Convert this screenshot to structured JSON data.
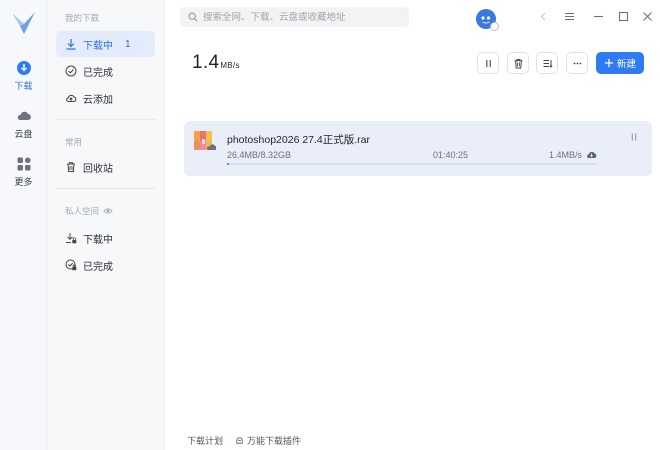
{
  "rail": {
    "items": [
      {
        "label": "下载"
      },
      {
        "label": "云盘"
      },
      {
        "label": "更多"
      }
    ]
  },
  "sidebar": {
    "section_mine": "我的下载",
    "downloading": {
      "label": "下载中",
      "count": "1"
    },
    "completed": "已完成",
    "cloud_add": "云添加",
    "section_common": "常用",
    "recycle": "回收站",
    "section_private": "私人空间",
    "private_downloading": "下载中",
    "private_completed": "已完成"
  },
  "search": {
    "placeholder": "搜索全网、下载、云盘或收藏地址"
  },
  "summary": {
    "speed_value": "1.4",
    "speed_unit": "MB/s"
  },
  "toolbar": {
    "new_label": "新建"
  },
  "task": {
    "name": "photoshop2026 27.4正式版.rar",
    "size": "26.4MB/8.32GB",
    "time_left": "01:40:25",
    "speed": "1.4MB/s",
    "progress": 0.0031
  },
  "footer": {
    "plan": "下载计划",
    "plugin": "万能下载插件"
  },
  "colors": {
    "accent": "#2f7bf5",
    "active_bg": "#e4ebfa",
    "task_bg": "#e9eef8"
  }
}
